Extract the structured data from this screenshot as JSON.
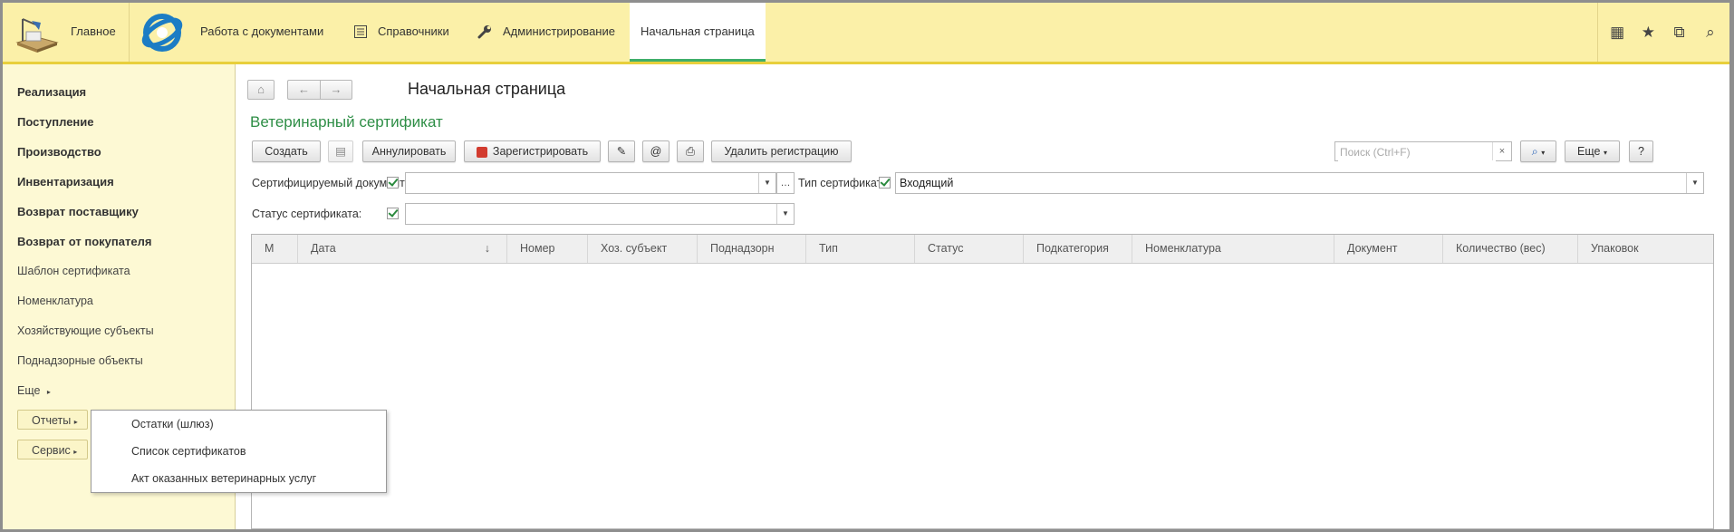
{
  "topbar": {
    "sections": [
      {
        "label": "Главное"
      },
      {
        "label": "Работа с документами"
      },
      {
        "label": "Справочники"
      },
      {
        "label": "Администрирование"
      },
      {
        "label": "Начальная страница"
      }
    ],
    "right_icons": [
      "apps-grid-icon",
      "star-icon",
      "history-icon",
      "search-icon"
    ]
  },
  "sidebar": {
    "bold_items": [
      "Реализация",
      "Поступление",
      "Производство",
      "Инвентаризация",
      "Возврат поставщику",
      "Возврат от покупателя"
    ],
    "items": [
      "Шаблон сертификата",
      "Номенклатура",
      "Хозяйствующие субъекты",
      "Поднадзорные объекты"
    ],
    "more_label": "Еще",
    "reports_label": "Отчеты",
    "service_label": "Сервис"
  },
  "dropdown": {
    "items": [
      "Остатки (шлюз)",
      "Список сертификатов",
      "Акт оказанных ветеринарных услуг"
    ]
  },
  "content": {
    "page_title": "Начальная страница",
    "form_title": "Ветеринарный сертификат",
    "toolbar": {
      "create": "Создать",
      "cancel": "Аннулировать",
      "register": "Зарегистрировать",
      "at": "@",
      "delete_registration": "Удалить регистрацию",
      "more": "Еще",
      "help": "?"
    },
    "search": {
      "placeholder": "Поиск (Ctrl+F)",
      "value": ""
    },
    "filters": {
      "cert_doc_label": "Сертифицируемый документ:",
      "cert_doc_value": "",
      "cert_type_label": "Тип сертификата:",
      "cert_type_value": "Входящий",
      "status_label": "Статус сертификата:",
      "status_value": ""
    },
    "table": {
      "columns": [
        "М",
        "Дата",
        "Номер",
        "Хоз. субъект",
        "Поднадзорн",
        "Тип",
        "Статус",
        "Подкатегория",
        "Номенклатура",
        "Документ",
        "Количество (вес)",
        "Упаковок"
      ],
      "rows": []
    }
  },
  "colors": {
    "topbar_bg": "#fbf0a8",
    "sidebar_bg": "#fdf9d4",
    "accent_green": "#2e8e46",
    "active_underline": "#3fae6a"
  }
}
